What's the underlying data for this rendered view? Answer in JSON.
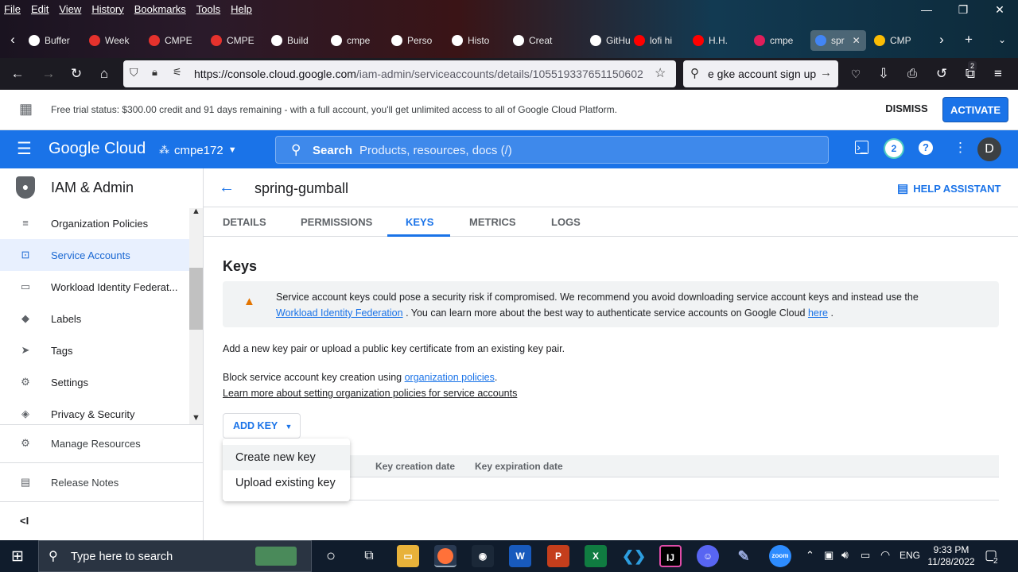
{
  "browser": {
    "menu": [
      "File",
      "Edit",
      "View",
      "History",
      "Bookmarks",
      "Tools",
      "Help"
    ],
    "tabs": [
      {
        "label": "Buffer",
        "color": "#ffffff"
      },
      {
        "label": "Week",
        "color": "#e5322d"
      },
      {
        "label": "CMPE",
        "color": "#e5322d"
      },
      {
        "label": "CMPE",
        "color": "#e5322d"
      },
      {
        "label": "Build",
        "color": "#ffffff"
      },
      {
        "label": "cmpe",
        "color": "#ffffff"
      },
      {
        "label": "Perso",
        "color": "#ffffff"
      },
      {
        "label": "Histo",
        "color": "#ffffff"
      },
      {
        "label": "Creat",
        "color": "#ffffff"
      },
      {
        "label": "GitHu",
        "color": "#ffffff"
      },
      {
        "label": "lofi hi",
        "color": "#ff0000"
      },
      {
        "label": "H.H.",
        "color": "#ff0000"
      },
      {
        "label": "cmpe",
        "color": "#e01e5a"
      },
      {
        "label": "spr",
        "color": "#4285f4",
        "active": true
      },
      {
        "label": "CMP",
        "color": "#fbbc04"
      }
    ],
    "url_main": "https://console.cloud.google.com",
    "url_rest": "/iam-admin/serviceaccounts/details/105519337651150602",
    "search_text": "e gke account sign up",
    "ext_badge": "2"
  },
  "trial": {
    "message": "Free trial status: $300.00 credit and 91 days remaining - with a full account, you'll get unlimited access to all of Google Cloud Platform.",
    "dismiss": "DISMISS",
    "activate": "ACTIVATE"
  },
  "header": {
    "brand": "Google Cloud",
    "project": "cmpe172",
    "search_label": "Search",
    "search_placeholder": "Products, resources, docs (/)",
    "notifications": "2",
    "avatar": "D"
  },
  "sidebar": {
    "product": "IAM & Admin",
    "items": [
      {
        "label": "Organization Policies",
        "icon": "≡"
      },
      {
        "label": "Service Accounts",
        "icon": "⊡",
        "active": true
      },
      {
        "label": "Workload Identity Federat...",
        "icon": "▭"
      },
      {
        "label": "Labels",
        "icon": "◆"
      },
      {
        "label": "Tags",
        "icon": "➤"
      },
      {
        "label": "Settings",
        "icon": "⚙"
      },
      {
        "label": "Privacy & Security",
        "icon": "◈"
      }
    ],
    "bottom": [
      {
        "label": "Manage Resources",
        "icon": "⚙"
      },
      {
        "label": "Release Notes",
        "icon": "▤"
      }
    ],
    "collapse": "<I"
  },
  "page": {
    "title": "spring-gumball",
    "help_assistant": "HELP ASSISTANT",
    "tabs": [
      "DETAILS",
      "PERMISSIONS",
      "KEYS",
      "METRICS",
      "LOGS"
    ],
    "active_tab": "KEYS",
    "keys_heading": "Keys",
    "warning_line1": "Service account keys could pose a security risk if compromised. We recommend you avoid downloading service account keys and instead use the",
    "warning_link1": "Workload Identity Federation",
    "warning_line2": ". You can learn more about the best way to authenticate service accounts on Google Cloud",
    "warning_link2": "here",
    "warning_end": ".",
    "add_pair_text": "Add a new key pair or upload a public key certificate from an existing key pair.",
    "block_text": "Block service account key creation using",
    "block_link": "organization policies",
    "block_end": ".",
    "learn_more": "Learn more about setting organization policies for service accounts",
    "add_key": "ADD KEY",
    "columns": [
      "Key creation date",
      "Key expiration date"
    ],
    "menu": [
      "Create new key",
      "Upload existing key"
    ]
  },
  "taskbar": {
    "search_placeholder": "Type here to search",
    "language": "ENG",
    "time": "9:33 PM",
    "date": "11/28/2022",
    "notif_count": "2"
  }
}
